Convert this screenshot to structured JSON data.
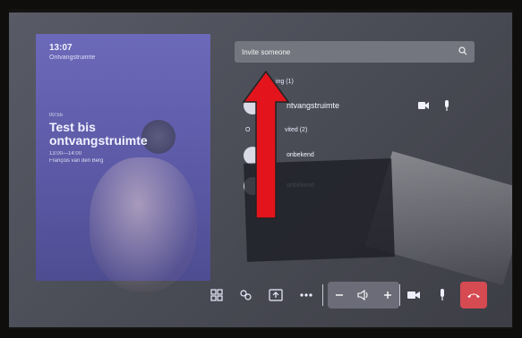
{
  "left_panel": {
    "time": "13:07",
    "room": "Ontvangstruimte",
    "duration": "00:55",
    "meeting_title": "Test bis ontvangstruimte",
    "time_range": "13:00—14:00",
    "organizer": "François van den Berg"
  },
  "invite": {
    "placeholder": "Invite someone"
  },
  "participants": {
    "joined_section": "ing (1)",
    "joined_name": "ntvangstruimte",
    "invited_section": "O",
    "invited_section_suffix": "vited (2)",
    "invited": [
      {
        "name": "onbekend"
      },
      {
        "name": "onbekend"
      }
    ]
  },
  "colors": {
    "accent": "#6b69b9",
    "end_call": "#d64a52",
    "arrow": "#e3141c"
  }
}
